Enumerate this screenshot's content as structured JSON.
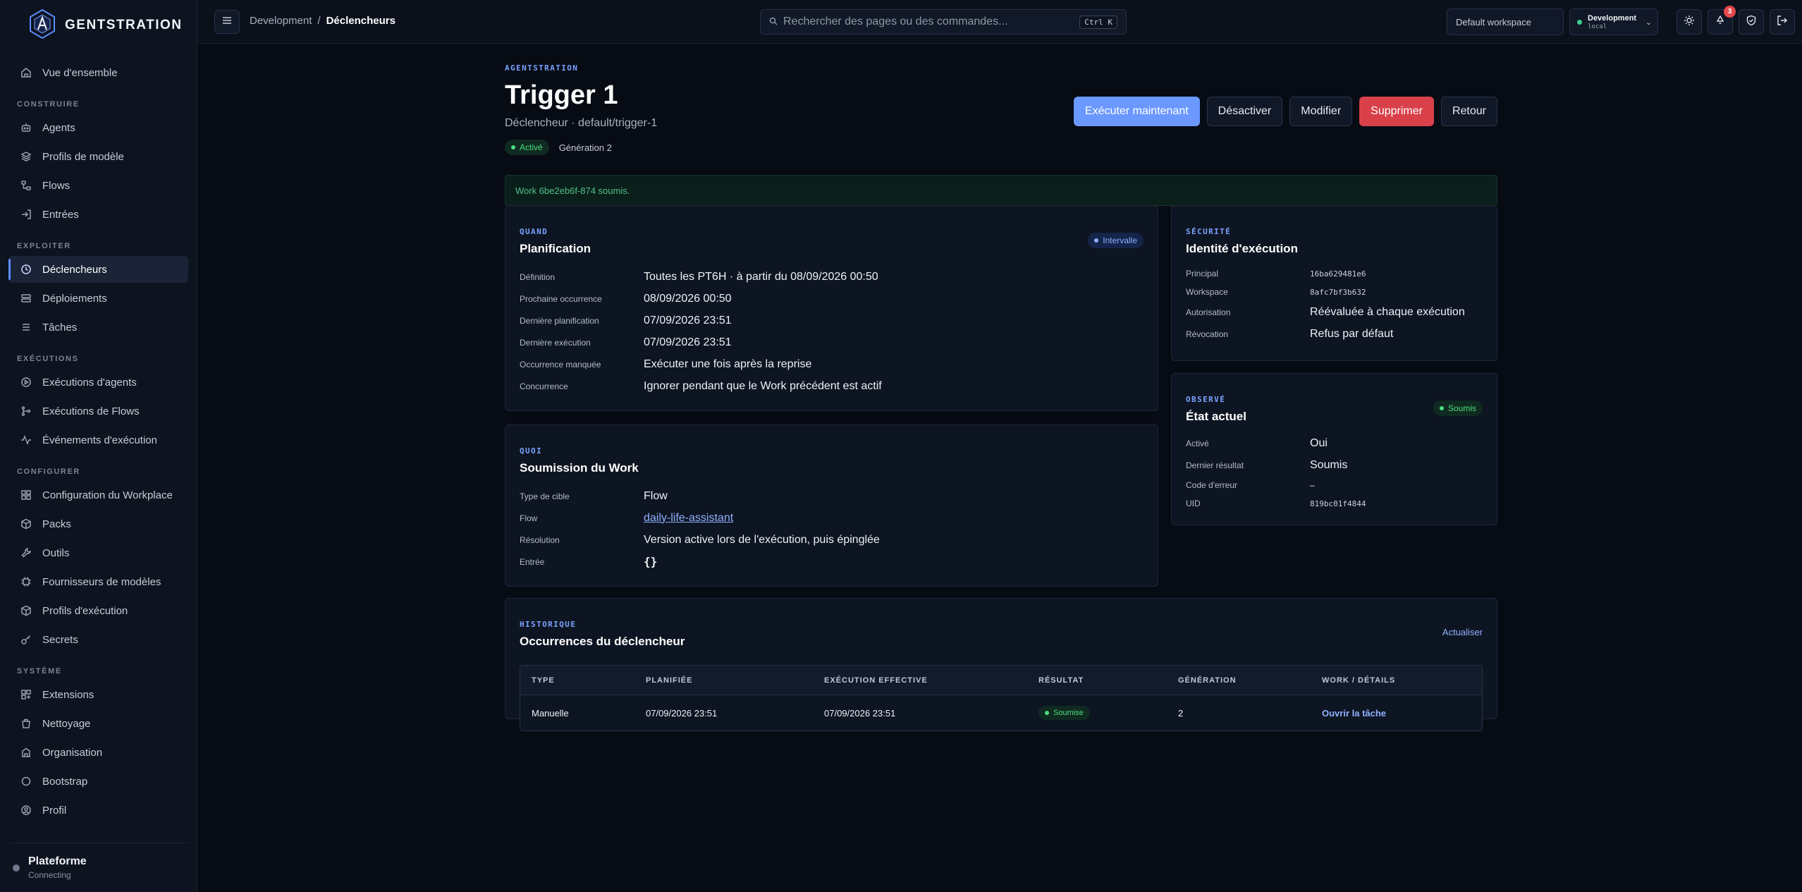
{
  "brand": {
    "name": "GENTSTRATION"
  },
  "sidebar": {
    "top": {
      "label": "Vue d'ensemble",
      "icon": "home-icon"
    },
    "sections": [
      {
        "title": "CONSTRUIRE",
        "items": [
          {
            "label": "Agents",
            "icon": "robot-icon"
          },
          {
            "label": "Profils de modèle",
            "icon": "stack-icon"
          },
          {
            "label": "Flows",
            "icon": "flow-icon"
          },
          {
            "label": "Entrées",
            "icon": "login-icon"
          }
        ]
      },
      {
        "title": "EXPLOITER",
        "items": [
          {
            "label": "Déclencheurs",
            "icon": "clock-icon"
          },
          {
            "label": "Déploiements",
            "icon": "deploy-icon"
          },
          {
            "label": "Tâches",
            "icon": "list-icon"
          }
        ]
      },
      {
        "title": "EXÉCUTIONS",
        "items": [
          {
            "label": "Exécutions d'agents",
            "icon": "play-circle-icon"
          },
          {
            "label": "Exécutions de Flows",
            "icon": "branch-icon"
          },
          {
            "label": "Événements d'exécution",
            "icon": "activity-icon"
          }
        ]
      },
      {
        "title": "CONFIGURER",
        "items": [
          {
            "label": "Configuration du Workplace",
            "icon": "grid-icon"
          },
          {
            "label": "Packs",
            "icon": "box-icon"
          },
          {
            "label": "Outils",
            "icon": "wrench-icon"
          },
          {
            "label": "Fournisseurs de modèles",
            "icon": "chip-icon"
          },
          {
            "label": "Profils d'exécution",
            "icon": "cube-icon"
          },
          {
            "label": "Secrets",
            "icon": "key-icon"
          }
        ]
      },
      {
        "title": "SYSTÈME",
        "items": [
          {
            "label": "Extensions",
            "icon": "puzzle-icon"
          },
          {
            "label": "Nettoyage",
            "icon": "broom-icon"
          },
          {
            "label": "Organisation",
            "icon": "building-icon"
          },
          {
            "label": "Bootstrap",
            "icon": "circle-icon"
          },
          {
            "label": "Profil",
            "icon": "user-icon"
          }
        ]
      }
    ],
    "active_label": "Déclencheurs",
    "platform": {
      "title": "Plateforme",
      "status": "Connecting"
    }
  },
  "topbar": {
    "breadcrumb": {
      "parent": "Development",
      "separator": "/",
      "current": "Déclencheurs"
    },
    "search": {
      "placeholder": "Rechercher des pages ou des commandes...",
      "shortcut": "Ctrl K"
    },
    "workspace": "Default workspace",
    "environment": {
      "name": "Development",
      "sub": "local"
    },
    "notifications_count": "3"
  },
  "page": {
    "eyebrow": "AGENTSTRATION",
    "title": "Trigger 1",
    "subtitle": "Déclencheur · default/trigger-1",
    "status": "Activé",
    "generation": "Génération 2",
    "actions": {
      "run_now": "Exécuter maintenant",
      "disable": "Désactiver",
      "edit": "Modifier",
      "delete": "Supprimer",
      "back": "Retour"
    },
    "notice": "Work 6be2eb6f-874 soumis."
  },
  "when_card": {
    "eyebrow": "QUAND",
    "title": "Planification",
    "badge": "Intervalle",
    "rows": [
      {
        "k": "Définition",
        "v": "Toutes les PT6H · à partir du 08/09/2026 00:50"
      },
      {
        "k": "Prochaine occurrence",
        "v": "08/09/2026 00:50"
      },
      {
        "k": "Dernière planification",
        "v": "07/09/2026 23:51"
      },
      {
        "k": "Dernière exécution",
        "v": "07/09/2026 23:51"
      },
      {
        "k": "Occurrence manquée",
        "v": "Exécuter une fois après la reprise"
      },
      {
        "k": "Concurrence",
        "v": "Ignorer pendant que le Work précédent est actif"
      }
    ]
  },
  "what_card": {
    "eyebrow": "QUOI",
    "title": "Soumission du Work",
    "rows": [
      {
        "k": "Type de cible",
        "v": "Flow"
      },
      {
        "k": "Flow",
        "v": "daily-life-assistant"
      },
      {
        "k": "Résolution",
        "v": "Version active lors de l'exécution, puis épinglée"
      },
      {
        "k": "Entrée",
        "v": "{}"
      }
    ]
  },
  "security_card": {
    "eyebrow": "SÉCURITÉ",
    "title": "Identité d'exécution",
    "rows": [
      {
        "k": "Principal",
        "v": "16ba629481e6"
      },
      {
        "k": "Workspace",
        "v": "8afc7bf3b632"
      },
      {
        "k": "Autorisation",
        "v": "Réévaluée à chaque exécution"
      },
      {
        "k": "Révocation",
        "v": "Refus par défaut"
      }
    ]
  },
  "observed_card": {
    "eyebrow": "OBSERVÉ",
    "title": "État actuel",
    "badge": "Soumis",
    "rows": [
      {
        "k": "Activé",
        "v": "Oui"
      },
      {
        "k": "Dernier résultat",
        "v": "Soumis"
      },
      {
        "k": "Code d'erreur",
        "v": "–"
      },
      {
        "k": "UID",
        "v": "819bc01f4844"
      }
    ]
  },
  "history": {
    "eyebrow": "HISTORIQUE",
    "title": "Occurrences du déclencheur",
    "refresh": "Actualiser",
    "columns": [
      "TYPE",
      "PLANIFIÉE",
      "EXÉCUTION EFFECTIVE",
      "RÉSULTAT",
      "GÉNÉRATION",
      "WORK / DÉTAILS"
    ],
    "rows": [
      {
        "type": "Manuelle",
        "planned": "07/09/2026 23:51",
        "effective": "07/09/2026 23:51",
        "result": "Soumise",
        "generation": "2",
        "details": "Ouvrir la tâche"
      }
    ]
  }
}
